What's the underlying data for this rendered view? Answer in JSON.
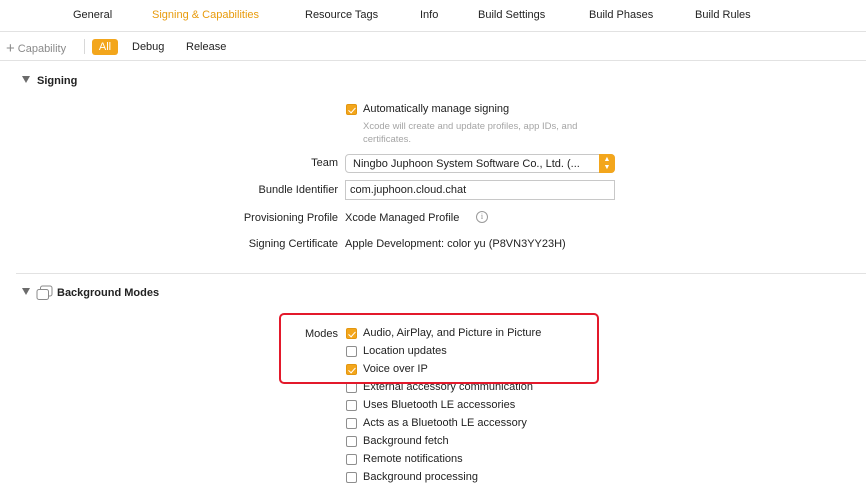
{
  "tabs": [
    "General",
    "Signing & Capabilities",
    "Resource Tags",
    "Info",
    "Build Settings",
    "Build Phases",
    "Build Rules"
  ],
  "active_tab": "Signing & Capabilities",
  "toolbar": {
    "add_capability": "Capability",
    "filters": [
      "All",
      "Debug",
      "Release"
    ],
    "selected_filter": "All"
  },
  "signing": {
    "title": "Signing",
    "auto_manage_label": "Automatically manage signing",
    "auto_manage_checked": true,
    "auto_manage_hint": "Xcode will create and update profiles, app IDs, and certificates.",
    "team_label": "Team",
    "team_value": "Ningbo Juphoon System Software Co., Ltd. (...",
    "bundle_label": "Bundle Identifier",
    "bundle_value": "com.juphoon.cloud.chat",
    "profile_label": "Provisioning Profile",
    "profile_value": "Xcode Managed Profile",
    "cert_label": "Signing Certificate",
    "cert_value": "Apple Development: color yu (P8VN3YY23H)"
  },
  "background_modes": {
    "title": "Background Modes",
    "modes_label": "Modes",
    "modes": [
      {
        "label": "Audio, AirPlay, and Picture in Picture",
        "checked": true
      },
      {
        "label": "Location updates",
        "checked": false
      },
      {
        "label": "Voice over IP",
        "checked": true
      },
      {
        "label": "External accessory communication",
        "checked": false
      },
      {
        "label": "Uses Bluetooth LE accessories",
        "checked": false
      },
      {
        "label": "Acts as a Bluetooth LE accessory",
        "checked": false
      },
      {
        "label": "Background fetch",
        "checked": false
      },
      {
        "label": "Remote notifications",
        "checked": false
      },
      {
        "label": "Background processing",
        "checked": false
      }
    ]
  },
  "colors": {
    "accent": "#f3a61c",
    "highlight": "#e3192b"
  }
}
